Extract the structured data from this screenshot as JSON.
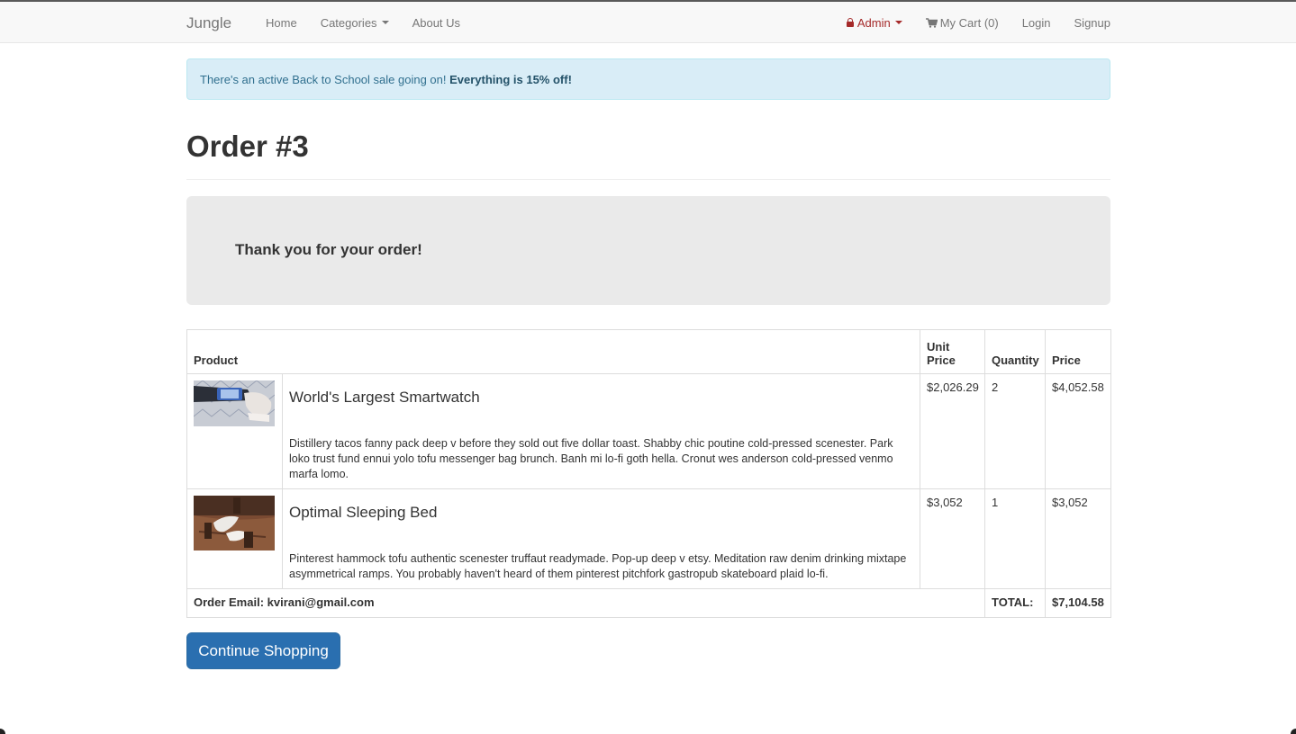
{
  "nav": {
    "brand": "Jungle",
    "left": [
      "Home",
      "Categories",
      "About Us"
    ],
    "admin": "Admin",
    "cart": "My Cart (0)",
    "login": "Login",
    "signup": "Signup"
  },
  "alert": {
    "text": "There's an active Back to School sale going on! ",
    "emphasis": "Everything is 15% off!"
  },
  "order": {
    "title": "Order #3",
    "thanks": "Thank you for your order!",
    "headers": {
      "product": "Product",
      "unit_price": "Unit Price",
      "quantity": "Quantity",
      "price": "Price"
    },
    "items": [
      {
        "name": "World's Largest Smartwatch",
        "description": "Distillery tacos fanny pack deep v before they sold out five dollar toast. Shabby chic poutine cold-pressed scenester. Park loko trust fund ennui yolo tofu messenger bag brunch. Banh mi lo-fi goth hella. Cronut wes anderson cold-pressed venmo marfa lomo.",
        "unit_price": "$2,026.29",
        "quantity": "2",
        "price": "$4,052.58"
      },
      {
        "name": "Optimal Sleeping Bed",
        "description": "Pinterest hammock tofu authentic scenester truffaut readymade. Pop-up deep v etsy. Meditation raw denim drinking mixtape asymmetrical ramps. You probably haven't heard of them pinterest pitchfork gastropub skateboard plaid lo-fi.",
        "unit_price": "$3,052",
        "quantity": "1",
        "price": "$3,052"
      }
    ],
    "email_label": "Order Email: kvirani@gmail.com",
    "total_label": "TOTAL:",
    "total": "$7,104.58"
  },
  "continue_label": "Continue Shopping",
  "colors": {
    "alert_bg": "#d9edf7",
    "alert_text": "#31708f",
    "admin": "#a52a2a",
    "button": "#2a6fb0"
  }
}
